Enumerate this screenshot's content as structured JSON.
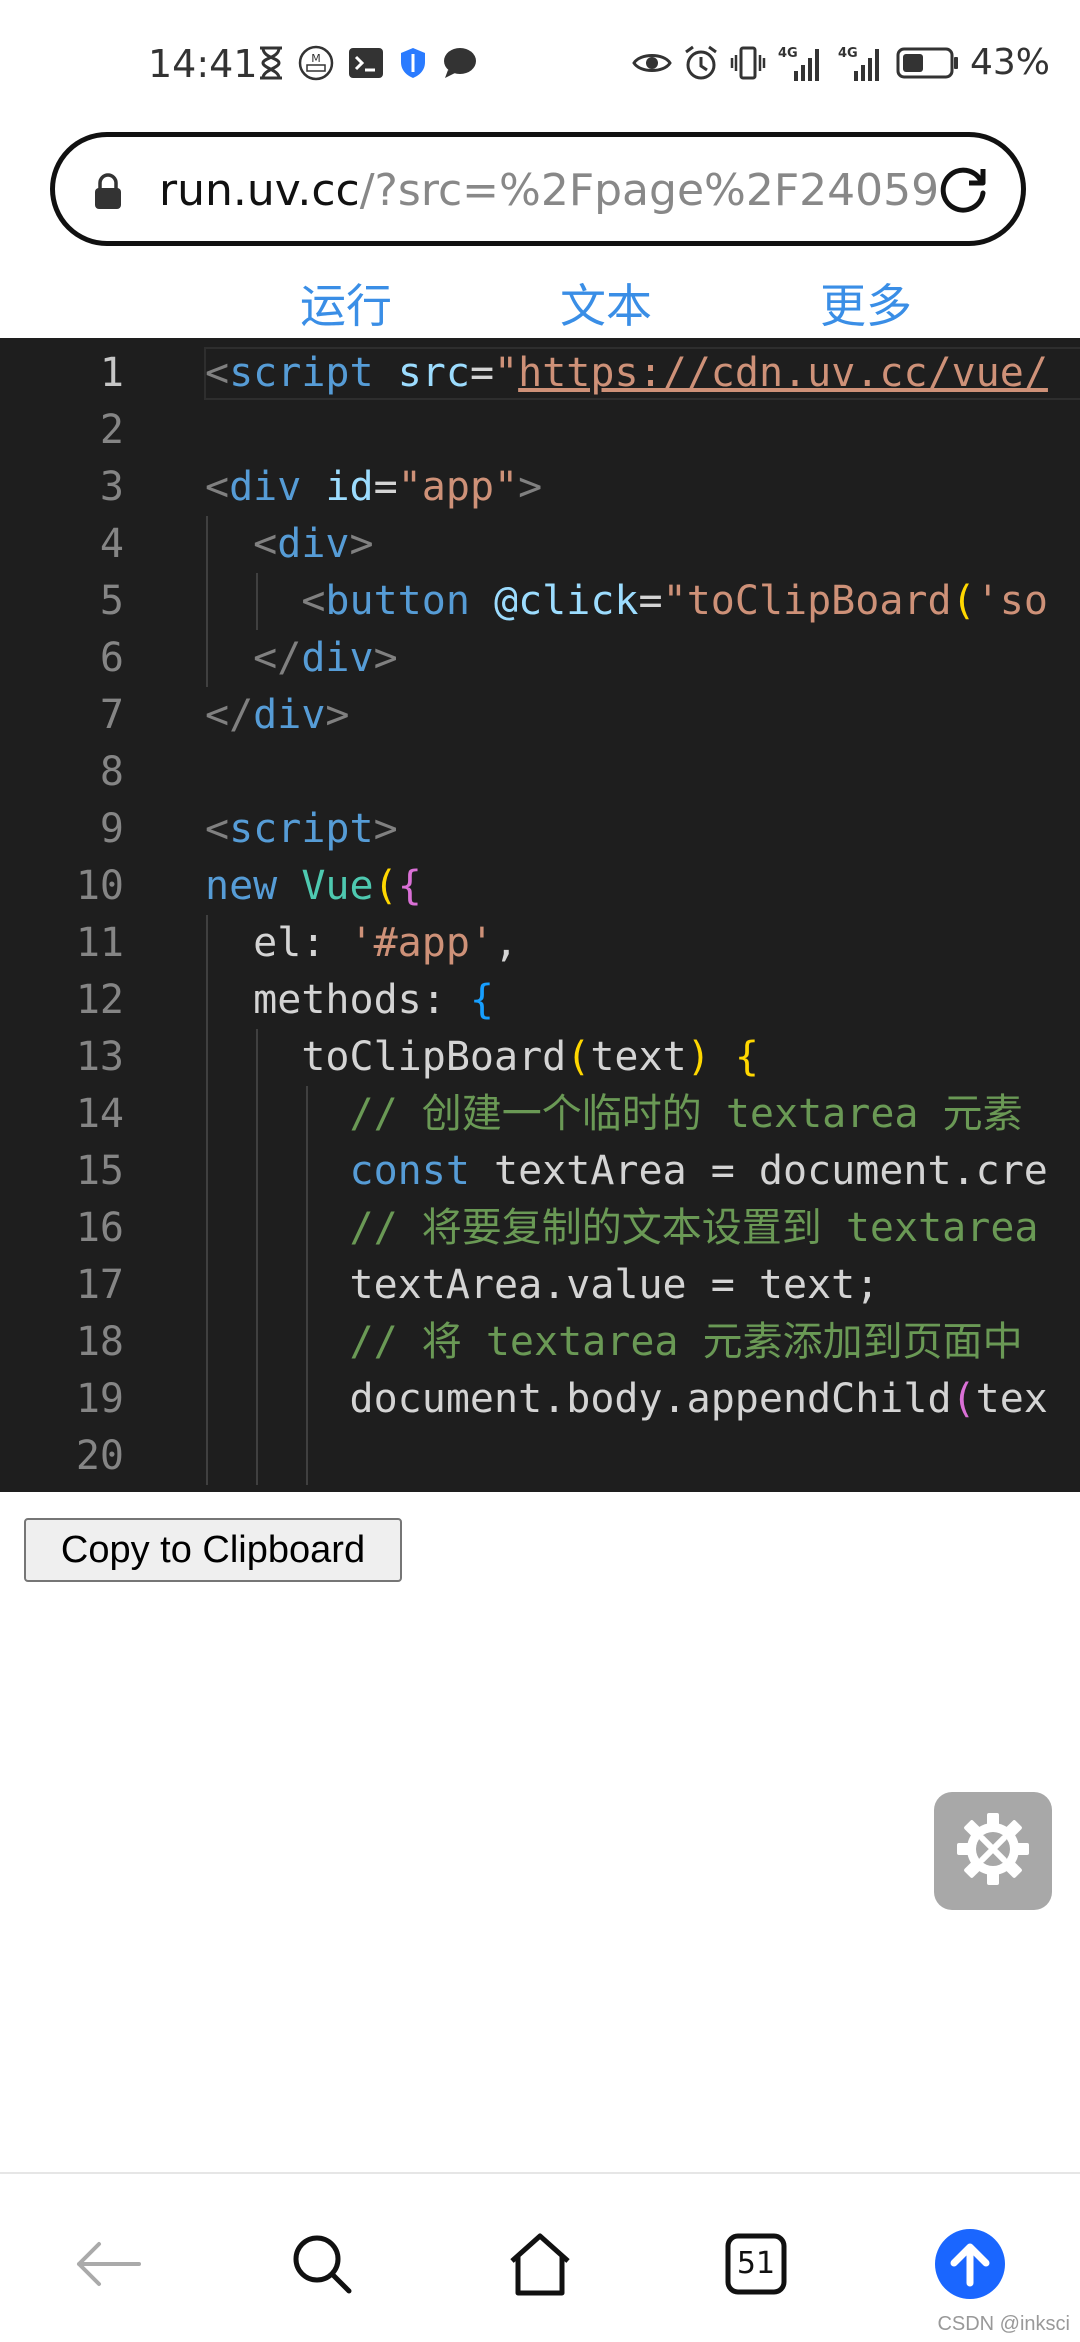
{
  "status_bar": {
    "time": "14:41",
    "battery_percent": "43%",
    "network_1": "4G",
    "network_2": "4G",
    "left_icons": [
      "hourglass-icon",
      "metro-icon",
      "terminal-icon",
      "shield-icon",
      "chat-bubble-icon"
    ],
    "right_icons": [
      "eye-icon",
      "alarm-icon",
      "vibrate-icon",
      "signal-icon",
      "signal-icon",
      "battery-icon"
    ]
  },
  "address_bar": {
    "url_host": "run.uv.cc",
    "url_rest": "/?src=%2Fpage%2F24059"
  },
  "toolbar": {
    "run_label": "运行",
    "text_label": "文本",
    "more_label": "更多"
  },
  "editor": {
    "line_numbers": [
      "1",
      "2",
      "3",
      "4",
      "5",
      "6",
      "7",
      "8",
      "9",
      "10",
      "11",
      "12",
      "13",
      "14",
      "15",
      "16",
      "17",
      "18",
      "19",
      "20"
    ],
    "lines": [
      [
        {
          "c": "t-tag",
          "t": "<"
        },
        {
          "c": "t-name",
          "t": "script"
        },
        {
          "c": "t-txt",
          "t": " "
        },
        {
          "c": "t-attr",
          "t": "src"
        },
        {
          "c": "t-txt",
          "t": "="
        },
        {
          "c": "t-str",
          "t": "\""
        },
        {
          "c": "t-str uline",
          "t": "https://cdn.uv.cc/vue/"
        }
      ],
      [],
      [
        {
          "c": "t-tag",
          "t": "<"
        },
        {
          "c": "t-name",
          "t": "div"
        },
        {
          "c": "t-txt",
          "t": " "
        },
        {
          "c": "t-attr",
          "t": "id"
        },
        {
          "c": "t-txt",
          "t": "="
        },
        {
          "c": "t-str",
          "t": "\"app\""
        },
        {
          "c": "t-tag",
          "t": ">"
        }
      ],
      [
        {
          "c": "t-txt",
          "t": "  "
        },
        {
          "c": "t-tag",
          "t": "<"
        },
        {
          "c": "t-name",
          "t": "div"
        },
        {
          "c": "t-tag",
          "t": ">"
        }
      ],
      [
        {
          "c": "t-txt",
          "t": "    "
        },
        {
          "c": "t-tag",
          "t": "<"
        },
        {
          "c": "t-name",
          "t": "button"
        },
        {
          "c": "t-txt",
          "t": " "
        },
        {
          "c": "t-attr",
          "t": "@click"
        },
        {
          "c": "t-txt",
          "t": "="
        },
        {
          "c": "t-str",
          "t": "\"toClipBoard"
        },
        {
          "c": "t-brk3",
          "t": "("
        },
        {
          "c": "t-str",
          "t": "'so"
        }
      ],
      [
        {
          "c": "t-txt",
          "t": "  "
        },
        {
          "c": "t-tag",
          "t": "</"
        },
        {
          "c": "t-name",
          "t": "div"
        },
        {
          "c": "t-tag",
          "t": ">"
        }
      ],
      [
        {
          "c": "t-tag",
          "t": "</"
        },
        {
          "c": "t-name",
          "t": "div"
        },
        {
          "c": "t-tag",
          "t": ">"
        }
      ],
      [],
      [
        {
          "c": "t-tag",
          "t": "<"
        },
        {
          "c": "t-name",
          "t": "script"
        },
        {
          "c": "t-tag",
          "t": ">"
        }
      ],
      [
        {
          "c": "t-kw",
          "t": "new"
        },
        {
          "c": "t-txt",
          "t": " "
        },
        {
          "c": "t-cls",
          "t": "Vue"
        },
        {
          "c": "t-brk3",
          "t": "("
        },
        {
          "c": "t-brk1",
          "t": "{"
        }
      ],
      [
        {
          "c": "t-txt",
          "t": "  el: "
        },
        {
          "c": "t-str",
          "t": "'#app'"
        },
        {
          "c": "t-txt",
          "t": ","
        }
      ],
      [
        {
          "c": "t-txt",
          "t": "  methods: "
        },
        {
          "c": "t-brk2",
          "t": "{"
        }
      ],
      [
        {
          "c": "t-txt",
          "t": "    toClipBoard"
        },
        {
          "c": "t-brk3",
          "t": "("
        },
        {
          "c": "t-txt",
          "t": "text"
        },
        {
          "c": "t-brk3",
          "t": ")"
        },
        {
          "c": "t-txt",
          "t": " "
        },
        {
          "c": "t-brk3",
          "t": "{"
        }
      ],
      [
        {
          "c": "t-txt",
          "t": "      "
        },
        {
          "c": "t-cmt",
          "t": "// 创建一个临时的 textarea 元素"
        }
      ],
      [
        {
          "c": "t-txt",
          "t": "      "
        },
        {
          "c": "t-kw",
          "t": "const"
        },
        {
          "c": "t-txt",
          "t": " textArea = document.cre"
        }
      ],
      [
        {
          "c": "t-txt",
          "t": "      "
        },
        {
          "c": "t-cmt",
          "t": "// 将要复制的文本设置到 textarea"
        }
      ],
      [
        {
          "c": "t-txt",
          "t": "      textArea.value = text;"
        }
      ],
      [
        {
          "c": "t-txt",
          "t": "      "
        },
        {
          "c": "t-cmt",
          "t": "// 将 textarea 元素添加到页面中"
        }
      ],
      [
        {
          "c": "t-txt",
          "t": "      document.body.appendChild"
        },
        {
          "c": "t-brk1",
          "t": "("
        },
        {
          "c": "t-txt",
          "t": "tex"
        }
      ],
      []
    ]
  },
  "result": {
    "copy_button_label": "Copy to Clipboard"
  },
  "bottom_nav": {
    "tab_count": "51"
  },
  "watermark": "CSDN @inksci"
}
